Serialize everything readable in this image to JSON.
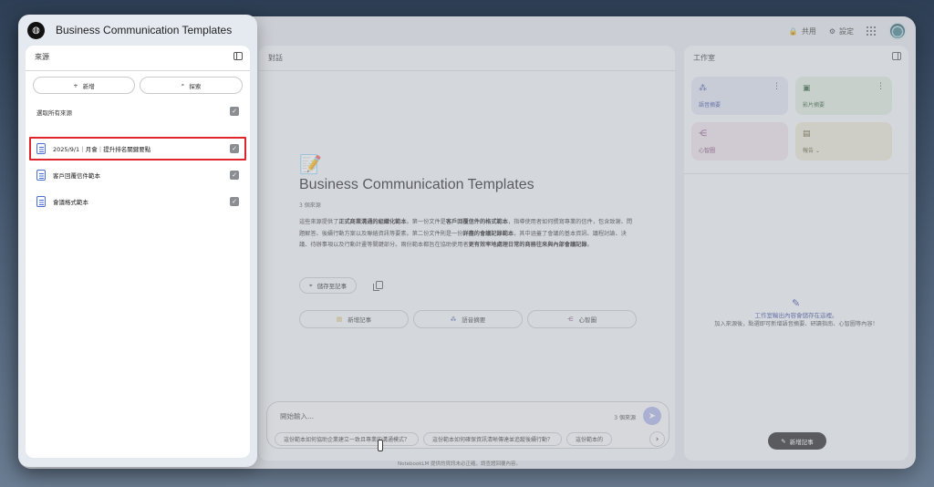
{
  "app": {
    "title": "Business Communication Templates",
    "logo_icon": "notebooklm-logo-icon"
  },
  "header": {
    "share_label": "共用",
    "settings_label": "設定"
  },
  "sources": {
    "panel_title": "來源",
    "add_label": "新增",
    "search_label": "探索",
    "select_all_label": "選取所有來源",
    "items": [
      {
        "label": "2025/9/1｜月會｜提升排名關鍵要點",
        "checked": true,
        "highlighted": true
      },
      {
        "label": "客戶回覆信件範本",
        "checked": true
      },
      {
        "label": "會議格式範本",
        "checked": true
      }
    ]
  },
  "chat": {
    "panel_title": "對話",
    "notebook_title": "Business Communication Templates",
    "source_count": "3 個來源",
    "summary_parts": [
      "這些來源提供了",
      "正式商業溝通的組織化範本",
      "。第一份文件是",
      "客戶回覆信件的格式範本",
      "，指導使用者如何撰寫專業的信件，包含致謝、問題解答、後續行動方案以及聯絡資訊等要素。第二份文件則是一份",
      "詳盡的會議記錄範本",
      "，其中涵蓋了會議的基本資訊、議程討論、決議、待辦事項以及行動計畫等關鍵部分。兩份範本都旨在協助使用者",
      "更有效率地處理日常的商務往來與內部會議記錄",
      "。"
    ],
    "save_note_label": "儲存至記事",
    "actions": [
      {
        "label": "新增記事",
        "icon": "note-add-icon"
      },
      {
        "label": "語音摘要",
        "icon": "audio-overview-icon"
      },
      {
        "label": "心智圖",
        "icon": "mind-map-icon"
      }
    ],
    "composer_placeholder": "開始輸入...",
    "composer_source_count": "3 個來源",
    "suggestions": [
      "這份範本如何協助企業建立一致且專業的溝通模式？",
      "這份範本如何確保資訊清晰傳達並追蹤後續行動？",
      "這份範本的"
    ],
    "footnote": "NotebookLM 提供的資訊未必正確，請查證回覆內容。"
  },
  "studio": {
    "panel_title": "工作室",
    "tiles": [
      {
        "label": "語音摘要",
        "icon": "audio-overview-icon",
        "color": "#dde2f0",
        "more": true
      },
      {
        "label": "影片摘要",
        "icon": "video-overview-icon",
        "color": "#dfe8dc",
        "more": true
      },
      {
        "label": "心智圖",
        "icon": "mind-map-icon",
        "color": "#ecdfe8"
      },
      {
        "label": "報告",
        "icon": "report-icon",
        "color": "#ebe6d3"
      }
    ],
    "empty_title": "工作室輸出內容會儲存在這裡。",
    "empty_desc": "加入來源後，點選即可新增語音摘要、研讀指南、心智圖等內容！",
    "add_note_label": "新增記事"
  }
}
